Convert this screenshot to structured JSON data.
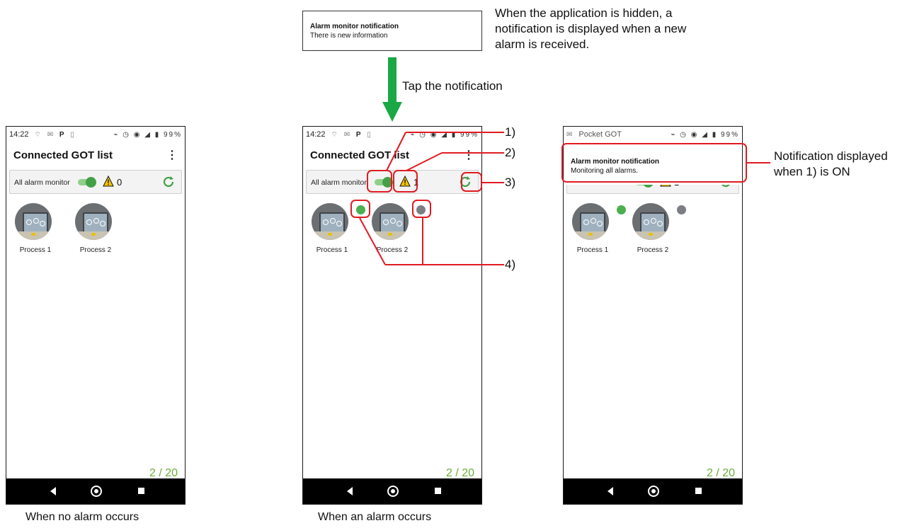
{
  "top_notification": {
    "title": "Alarm monitor notification",
    "body": "There is new information"
  },
  "top_annotation": "When the application is hidden, a notification is displayed when a new alarm is received.",
  "tap_label": "Tap the notification",
  "status_time": "14:22",
  "status_battery": "99%",
  "status_app_name": "Pocket GOT",
  "app_title": "Connected GOT list",
  "monitor_label": "All alarm monitor",
  "screens": {
    "left": {
      "alarm_count": "0",
      "caption": "When no alarm occurs"
    },
    "middle": {
      "alarm_count": "1",
      "caption": "When an alarm occurs"
    },
    "right": {
      "alarm_count": "1"
    }
  },
  "got_items": [
    {
      "label": "Process 1",
      "status": "alarm",
      "status_color": "#4caf50"
    },
    {
      "label": "Process 2",
      "status": "no-alarm",
      "status_color": "#7d7d85"
    }
  ],
  "page_count": "2 / 20",
  "callouts": {
    "c1": "1)",
    "c2": "2)",
    "c3": "3)",
    "c4": "4)"
  },
  "shade_notification": {
    "title": "Alarm monitor notification",
    "body": "Monitoring all alarms."
  },
  "right_annotation": "Notification displayed when 1) is ON",
  "colors": {
    "accent_green": "#43a047",
    "page_count_green": "#6aae3a",
    "arrow_green": "#1aa845",
    "callout_red": "#e01b23",
    "warning_yellow": "#f5c400"
  }
}
